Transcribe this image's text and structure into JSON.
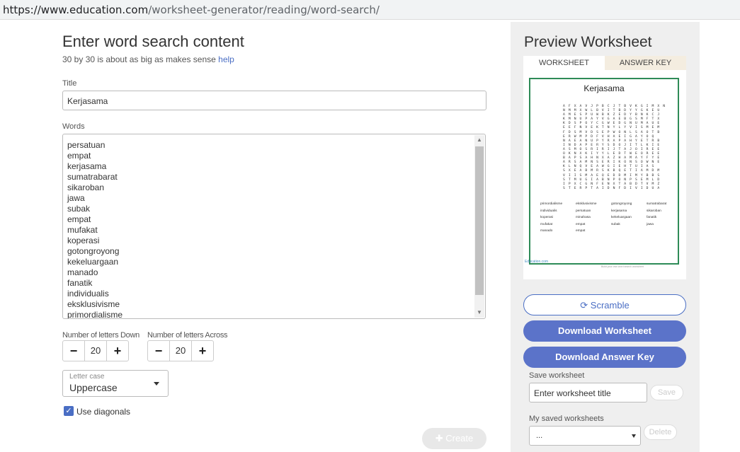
{
  "browser": {
    "url_host": "https://www.education.com",
    "url_path": "/worksheet-generator/reading/word-search/"
  },
  "form": {
    "heading": "Enter word search content",
    "subheading": "30 by 30 is about as big as makes sense",
    "help_link": "help",
    "title_label": "Title",
    "title_value": "Kerjasama",
    "words_label": "Words",
    "words": [
      "persatuan",
      "empat",
      "kerjasama",
      "sumatrabarat",
      "sikaroban",
      "jawa",
      "subak",
      "empat",
      "mufakat",
      "koperasi",
      "gotongroyong",
      "kekeluargaan",
      "manado",
      "fanatik",
      "individualis",
      "eksklusivisme",
      "primordialisme"
    ],
    "letters_down_label": "Number of letters Down",
    "letters_down_value": "20",
    "letters_across_label": "Number of letters Across",
    "letters_across_value": "20",
    "letter_case_label": "Letter case",
    "letter_case_value": "Uppercase",
    "diagonals_label": "Use diagonals",
    "diagonals_checked": true,
    "create_label": "Create"
  },
  "preview": {
    "heading": "Preview Worksheet",
    "tabs": [
      "WORKSHEET",
      "ANSWER KEY"
    ],
    "sheet_title": "Kerjasama",
    "grid_rows": [
      "A F X A V J P B C J T B V K G I M X N",
      "N M M X W L B V I T B D Y Y G K E U",
      "A M E S P U W B K Z E D Y B N K C J",
      "K M N U P A Y V G A E B G S M F T X",
      "K D S P O Y C G W E D G N U M A U E",
      "E E F N V E K T N Y L Y V I S M E M",
      "F D S M V D S E P W O N L S A O T B",
      "E R W M P D F V H A E I G A Y O Q",
      "N A E A N U P Y R A P A H Y E T R B",
      "I N D A P E R Y S D O J I T L K I E",
      "A S M O S R I R I J T A J O I R E E",
      "O K N X K I Y Y L E D T W E O R E E",
      "B A P S A H N X A Z H A M A Y F Y E",
      "A R S A M N S E R I K O N S O W N E",
      "K L N Q V E A W G I E H T U I A S",
      "S X E A B M R S K B Q E T I A M D M",
      "V I I S M A E Q E D D M I M Y B B S",
      "S T M U G I A B N P O N P S E M L D",
      "I P X C G N F E N X T A B D T V M Z",
      "S T E R P T A I D N F D I V I D U A"
    ],
    "word_list": [
      "primordialisme",
      "eksklusivisme",
      "gotongroyong",
      "sumatrabarat",
      "individualis",
      "persatuan",
      "kerjasama",
      "sikaroban",
      "koperasi",
      "minahasa",
      "kekeluargaan",
      "fanatik",
      "mufakat",
      "empat",
      "subak",
      "jawa",
      "manado",
      "empat"
    ],
    "logo_text": "Education.com",
    "footer_text": "Build your own word search worksheet",
    "scramble_label": "Scramble",
    "download_worksheet_label": "Download Worksheet",
    "download_answer_key_label": "Download Answer Key",
    "save_label": "Save worksheet",
    "save_placeholder": "Enter worksheet title",
    "save_button": "Save",
    "saved_label": "My saved worksheets",
    "saved_value": "...",
    "delete_button": "Delete"
  },
  "colors": {
    "accent": "#5b73c9",
    "sheet_border": "#2e8b57"
  }
}
